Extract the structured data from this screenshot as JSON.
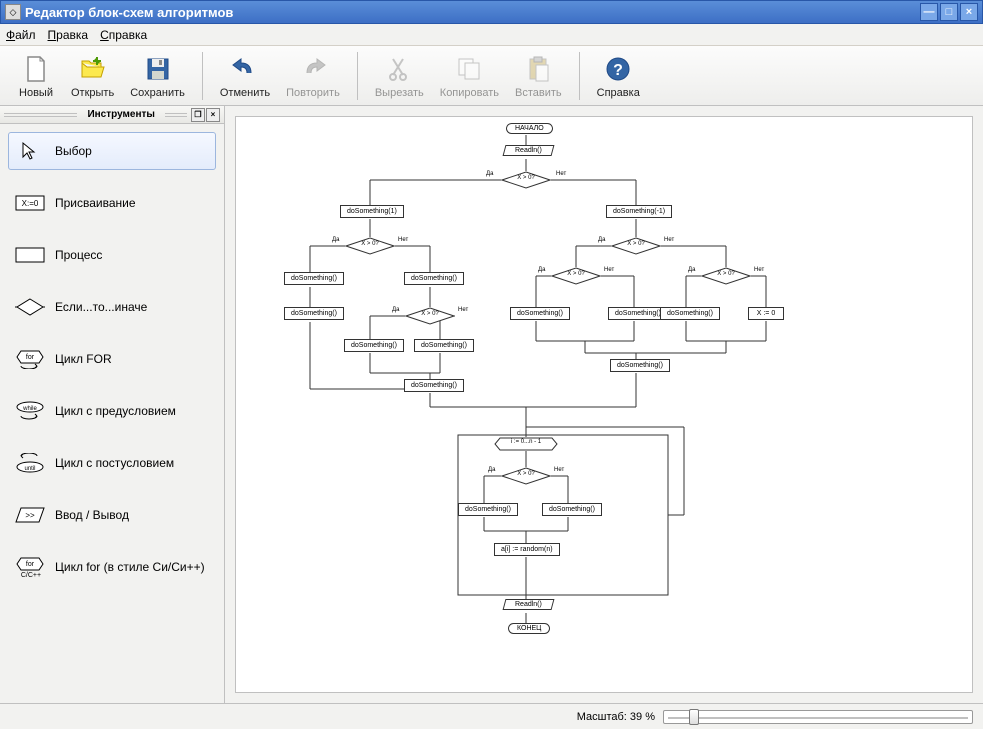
{
  "window": {
    "title": "Редактор блок-схем алгоритмов"
  },
  "menubar": {
    "file": "Файл",
    "edit": "Правка",
    "help": "Справка"
  },
  "toolbar": {
    "new": "Новый",
    "open": "Открыть",
    "save": "Сохранить",
    "undo": "Отменить",
    "redo": "Повторить",
    "cut": "Вырезать",
    "copy": "Копировать",
    "paste": "Вставить",
    "help": "Справка"
  },
  "tools": {
    "title": "Инструменты",
    "items": [
      {
        "label": "Выбор"
      },
      {
        "label": "Присваивание"
      },
      {
        "label": "Процесс"
      },
      {
        "label": "Если...то...иначе"
      },
      {
        "label": "Цикл FOR"
      },
      {
        "label": "Цикл с предусловием"
      },
      {
        "label": "Цикл с постусловием"
      },
      {
        "label": "Ввод / Вывод"
      },
      {
        "label": "Цикл for (в стиле Си/Си++)"
      }
    ]
  },
  "flowchart": {
    "start": "НАЧАЛО",
    "readln": "Readln()",
    "cond": "X > 0?",
    "yes": "Да",
    "no": "Нет",
    "do1": "doSomething(-1)",
    "do1p": "doSomething(1)",
    "do": "doSomething()",
    "xeq0": "X := 0",
    "loop": "i := 0...n - 1",
    "rand": "a[i] := random(n)",
    "end": "КОНЕЦ"
  },
  "status": {
    "zoom_label": "Масштаб: 39 %",
    "zoom_percent": 39
  }
}
